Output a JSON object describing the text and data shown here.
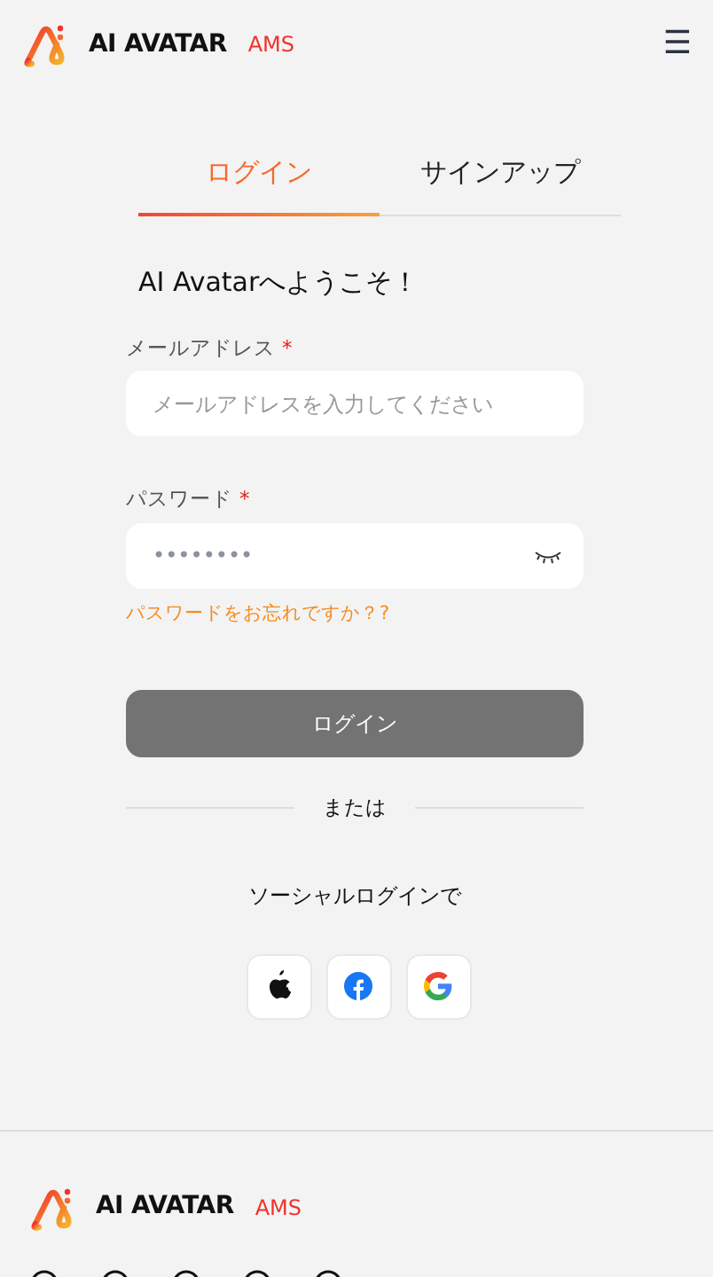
{
  "header": {
    "brand": "AI AVATAR",
    "tag": "AMS",
    "menu_icon": "☰"
  },
  "tabs": [
    {
      "label": "ログイン",
      "selected": true
    },
    {
      "label": "サインアップ",
      "selected": false
    }
  ],
  "welcome": "AI Avatarへようこそ！",
  "fields": [
    {
      "kind": "email",
      "label": "メールアドレス",
      "required": true,
      "required_mark": "*",
      "placeholder": "メールアドレスを入力してください"
    },
    {
      "kind": "password",
      "label": "パスワード",
      "required": true,
      "required_mark": "*",
      "value": "••••••••"
    }
  ],
  "forgot_link": "パスワードをお忘れですか？?",
  "login_button": {
    "label": "ログイン",
    "disabled": true
  },
  "divider_text": "または",
  "social_label": "ソーシャルログインで",
  "footer": {
    "brand": "AI AVATAR",
    "tag": "AMS"
  }
}
